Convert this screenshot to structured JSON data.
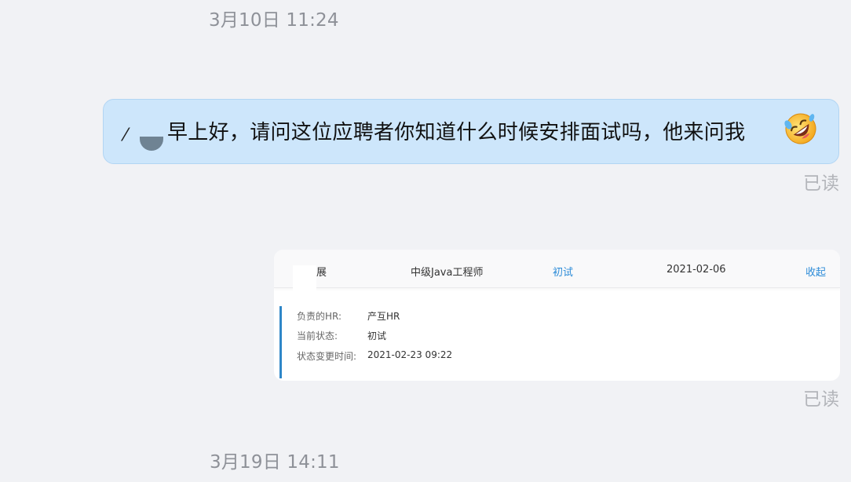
{
  "timestamps": [
    "3月10日 11:24",
    "3月19日 14:11"
  ],
  "message1": {
    "mention_visible": "⁄",
    "text": "早上好，请问这位应聘者你知道什么时候安排面试吗，他来问我",
    "emoji": "rolling-on-floor-laughing-emoji",
    "read_status": "已读",
    "bubble_color": "#cde6fb"
  },
  "message2": {
    "card": {
      "candidate_name": "展",
      "position": "中级Java工程师",
      "stage": "初试",
      "date": "2021-02-06",
      "collapse_label": "收起",
      "details": [
        {
          "label": "负责的HR:",
          "value": "产互HR"
        },
        {
          "label": "当前状态:",
          "value": "初试"
        },
        {
          "label": "状态变更时间:",
          "value": "2021-02-23 09:22"
        }
      ],
      "accent_color": "#2e86c8",
      "link_color": "#2d8cd8"
    },
    "read_status": "已读"
  }
}
